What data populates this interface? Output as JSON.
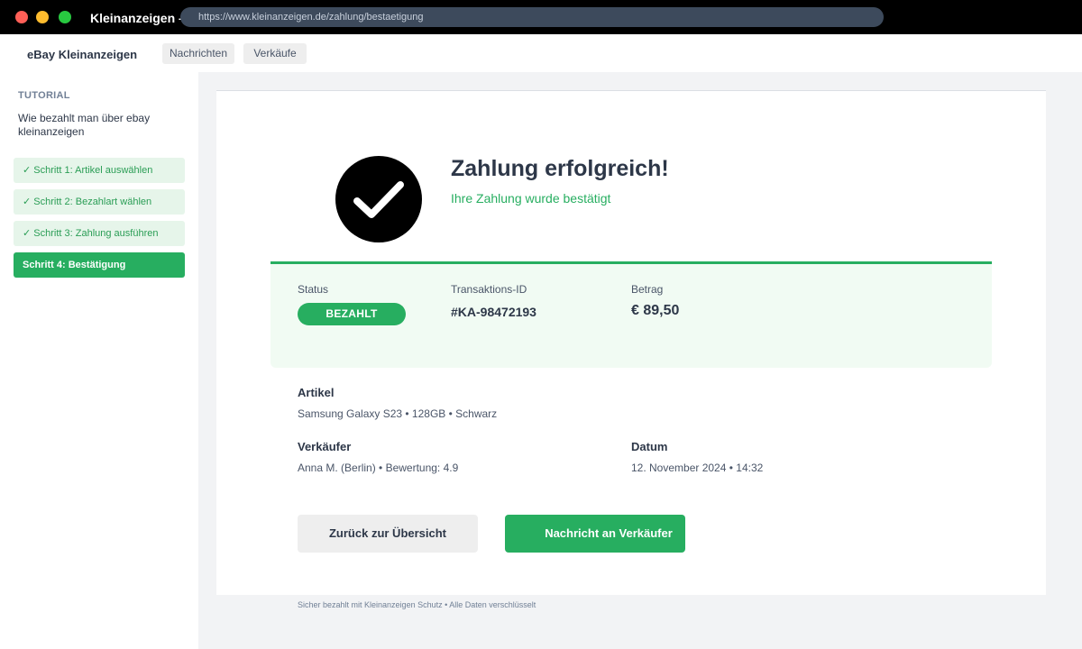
{
  "window": {
    "title": "Kleinanzeigen –",
    "url": "https://www.kleinanzeigen.de/zahlung/bestaetigung"
  },
  "topnav": {
    "brand": "eBay Kleinanzeigen",
    "tabs": [
      {
        "label": "Nachrichten"
      },
      {
        "label": "Verkäufe"
      }
    ]
  },
  "sidebar": {
    "heading": "TUTORIAL",
    "description": "Wie bezahlt man über ebay kleinanzeigen",
    "steps": [
      {
        "label": "✓ Schritt 1: Artikel auswählen",
        "state": "done"
      },
      {
        "label": "✓ Schritt 2: Bezahlart wählen",
        "state": "done"
      },
      {
        "label": "✓ Schritt 3: Zahlung ausführen",
        "state": "done"
      },
      {
        "label": "Schritt 4: Bestätigung",
        "state": "active"
      }
    ]
  },
  "main": {
    "icon": "checkmark-circle-icon",
    "title": "Zahlung erfolgreich!",
    "subtitle": "Ihre Zahlung wurde bestätigt",
    "summary": {
      "status_label": "Status",
      "status_value": "BEZAHLT",
      "transaction_label": "Transaktions-ID",
      "transaction_value": "#KA-98472193",
      "amount_label": "Betrag",
      "amount_value": "€ 89,50"
    },
    "details": {
      "article_label": "Artikel",
      "article_value": "Samsung Galaxy S23 • 128GB • Schwarz",
      "seller_label": "Verkäufer",
      "seller_value": "Anna M. (Berlin) • Bewertung: 4.9",
      "date_label": "Datum",
      "date_value": "12. November 2024 • 14:32"
    },
    "buttons": {
      "back_label": "Zurück zur Übersicht",
      "message_label": "Nachricht an Verkäufer"
    }
  },
  "footer": {
    "note": "Sicher bezahlt mit Kleinanzeigen Schutz • Alle Daten verschlüsselt"
  },
  "colors": {
    "accent": "#27ae60",
    "summary_bg": "#f1fbf3",
    "text_dark": "#2d3748"
  }
}
